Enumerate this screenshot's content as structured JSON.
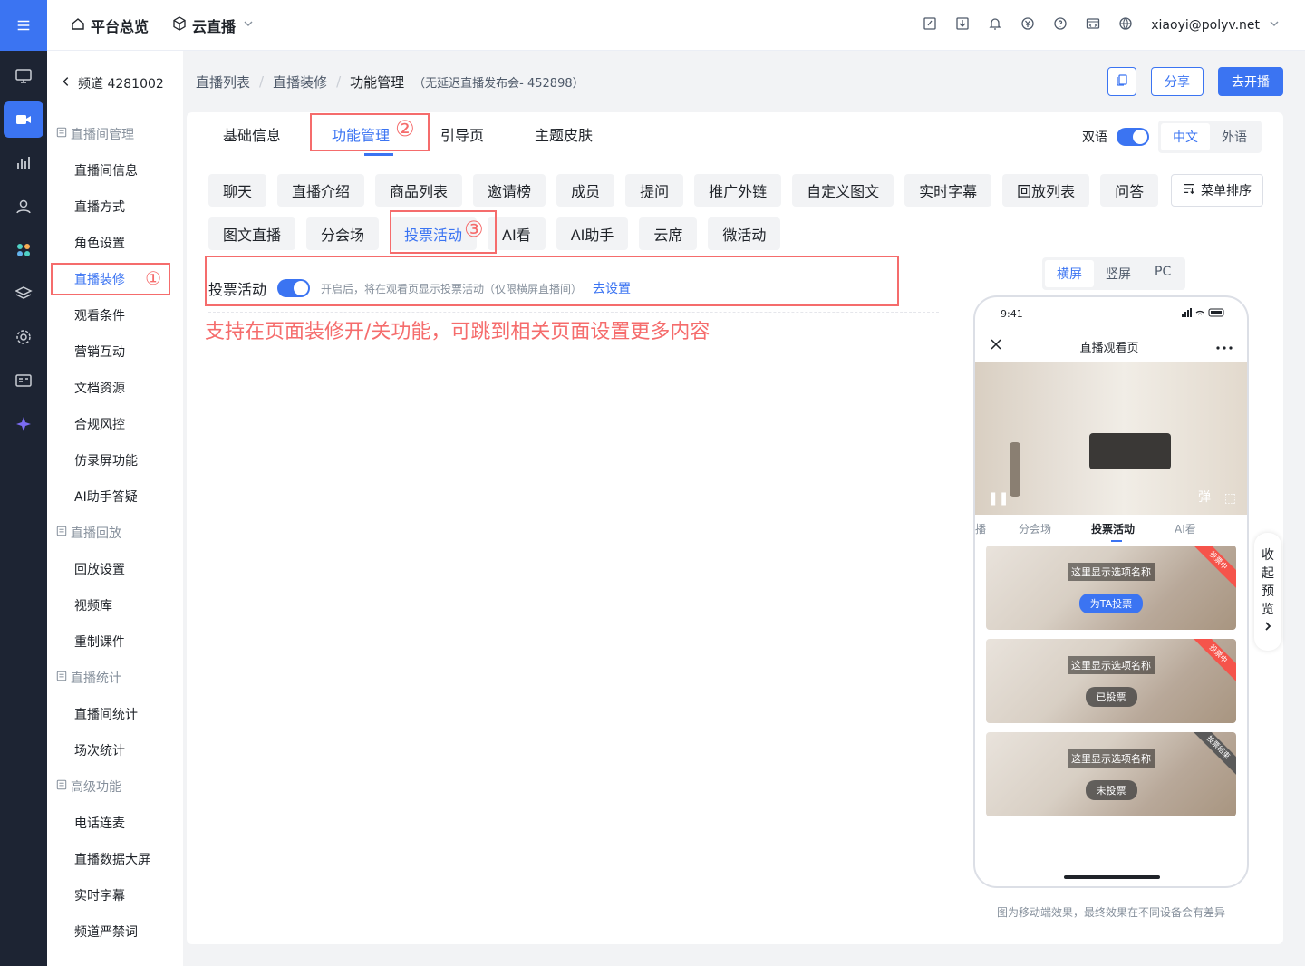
{
  "topbar": {
    "nav": [
      {
        "label": "平台总览",
        "icon": "home-icon"
      },
      {
        "label": "云直播",
        "icon": "cube-icon"
      }
    ],
    "user": "xiaoyi@polyv.net"
  },
  "sidebar": {
    "channel": "频道 4281002",
    "groups": [
      {
        "title": "直播间管理",
        "items": [
          "直播间信息",
          "直播方式",
          "角色设置",
          "直播装修",
          "观看条件",
          "营销互动",
          "文档资源",
          "合规风控",
          "仿录屏功能",
          "AI助手答疑"
        ]
      },
      {
        "title": "直播回放",
        "items": [
          "回放设置",
          "视频库",
          "重制课件"
        ]
      },
      {
        "title": "直播统计",
        "items": [
          "直播间统计",
          "场次统计"
        ]
      },
      {
        "title": "高级功能",
        "items": [
          "电话连麦",
          "直播数据大屏",
          "实时字幕",
          "频道严禁词"
        ]
      }
    ],
    "marker_1": "①"
  },
  "breadcrumb": {
    "items": [
      "直播列表",
      "直播装修",
      "功能管理"
    ],
    "sub": "（无延迟直播发布会- 452898）"
  },
  "actions": {
    "share": "分享",
    "start": "去开播"
  },
  "tabs": [
    "基础信息",
    "功能管理",
    "引导页",
    "主题皮肤"
  ],
  "marker_2": "②",
  "bilingual": {
    "label": "双语",
    "options": [
      "中文",
      "外语"
    ]
  },
  "chips_row1": [
    "聊天",
    "直播介绍",
    "商品列表",
    "邀请榜",
    "成员",
    "提问",
    "推广外链",
    "自定义图文",
    "实时字幕",
    "回放列表",
    "问答"
  ],
  "menu_sort": "菜单排序",
  "chips_row2": [
    "图文直播",
    "分会场",
    "投票活动",
    "AI看",
    "AI助手",
    "云席",
    "微活动"
  ],
  "marker_3": "③",
  "feature": {
    "label": "投票活动",
    "hint": "开启后，将在观看页显示投票活动（仅限横屏直播间）",
    "link": "去设置"
  },
  "annotation": "支持在页面装修开/关功能，可跳到相关页面设置更多内容",
  "preview": {
    "views": [
      "横屏",
      "竖屏",
      "PC"
    ],
    "time": "9:41",
    "title": "直播观看页",
    "tabs": [
      "播",
      "分会场",
      "投票活动",
      "AI看"
    ],
    "cards": [
      {
        "name": "这里显示选项名称",
        "button": "为TA投票",
        "ribbon": "投票中"
      },
      {
        "name": "这里显示选项名称",
        "button": "已投票",
        "ribbon": "投票中"
      },
      {
        "name": "这里显示选项名称",
        "button": "未投票",
        "ribbon": "投票结束"
      }
    ],
    "collapse": [
      "收",
      "起",
      "预",
      "览"
    ],
    "note": "图为移动端效果，最终效果在不同设备会有差异"
  }
}
